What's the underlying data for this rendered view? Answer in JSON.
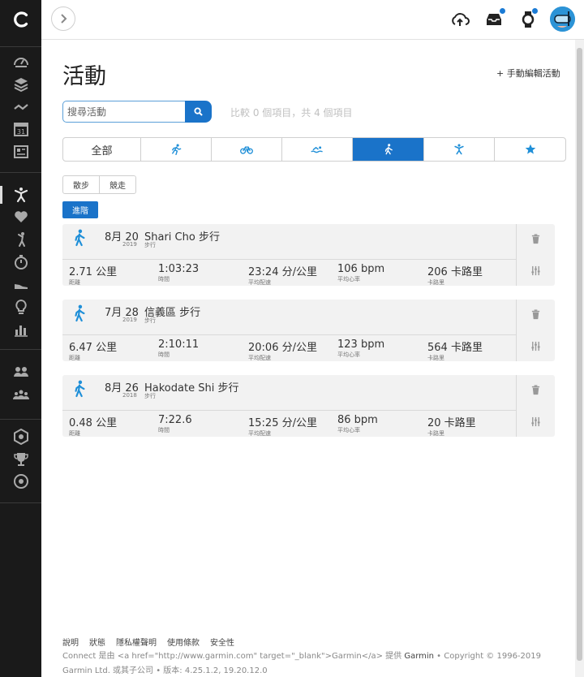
{
  "header": {
    "expand_icon": "chevron-right-icon",
    "upload_icon": "cloud-upload-icon",
    "inbox_icon": "inbox-icon",
    "device_icon": "watch-icon",
    "accent": "#1a73c9"
  },
  "page": {
    "title": "活動",
    "manual_add": "+ 手動編輯活動"
  },
  "search": {
    "placeholder": "搜尋活動",
    "compare_text": "比較 0 個項目，共 4 個項目"
  },
  "type_tabs": [
    {
      "label": "全部",
      "icon": ""
    },
    {
      "label": "",
      "icon": "running-icon"
    },
    {
      "label": "",
      "icon": "cycling-icon"
    },
    {
      "label": "",
      "icon": "swimming-icon"
    },
    {
      "label": "",
      "icon": "walking-icon",
      "active": true
    },
    {
      "label": "",
      "icon": "fitness-icon"
    },
    {
      "label": "",
      "icon": "star-icon"
    }
  ],
  "sub_tabs": [
    "散步",
    "競走"
  ],
  "advanced_label": "進階",
  "activities": [
    {
      "date": "8月 20",
      "year": "2019",
      "title": "Shari Cho 步行",
      "type": "步行",
      "distance": "2.71 公里",
      "distance_label": "距離",
      "time": "1:03:23",
      "time_label": "時間",
      "pace": "23:24 分/公里",
      "pace_label": "平均配速",
      "hr": "106 bpm",
      "hr_label": "平均心率",
      "calories": "206 卡路里",
      "calories_label": "卡路里"
    },
    {
      "date": "7月 28",
      "year": "2019",
      "title": "信義區 步行",
      "type": "步行",
      "distance": "6.47 公里",
      "distance_label": "距離",
      "time": "2:10:11",
      "time_label": "時間",
      "pace": "20:06 分/公里",
      "pace_label": "平均配速",
      "hr": "123 bpm",
      "hr_label": "平均心率",
      "calories": "564 卡路里",
      "calories_label": "卡路里"
    },
    {
      "date": "8月 26",
      "year": "2018",
      "title": "Hakodate Shi 步行",
      "type": "步行",
      "distance": "0.48 公里",
      "distance_label": "距離",
      "time": "7:22.6",
      "time_label": "時間",
      "pace": "15:25 分/公里",
      "pace_label": "平均配速",
      "hr": "86 bpm",
      "hr_label": "平均心率",
      "calories": "20 卡路里",
      "calories_label": "卡路里"
    }
  ],
  "footer": {
    "links": [
      "說明",
      "狀態",
      "隱私權聲明",
      "使用條款",
      "安全性"
    ],
    "copy_prefix": "Connect 是由 <a href=\"http://www.garmin.com\" target=\"_blank\">Garmin</a> 提供 ",
    "copy_brand": "Garmin",
    "copy_suffix": " • Copyright © 1996-2019 Garmin Ltd. 或其子公司 • 版本: 4.25.1.2, 19.20.12.0"
  }
}
